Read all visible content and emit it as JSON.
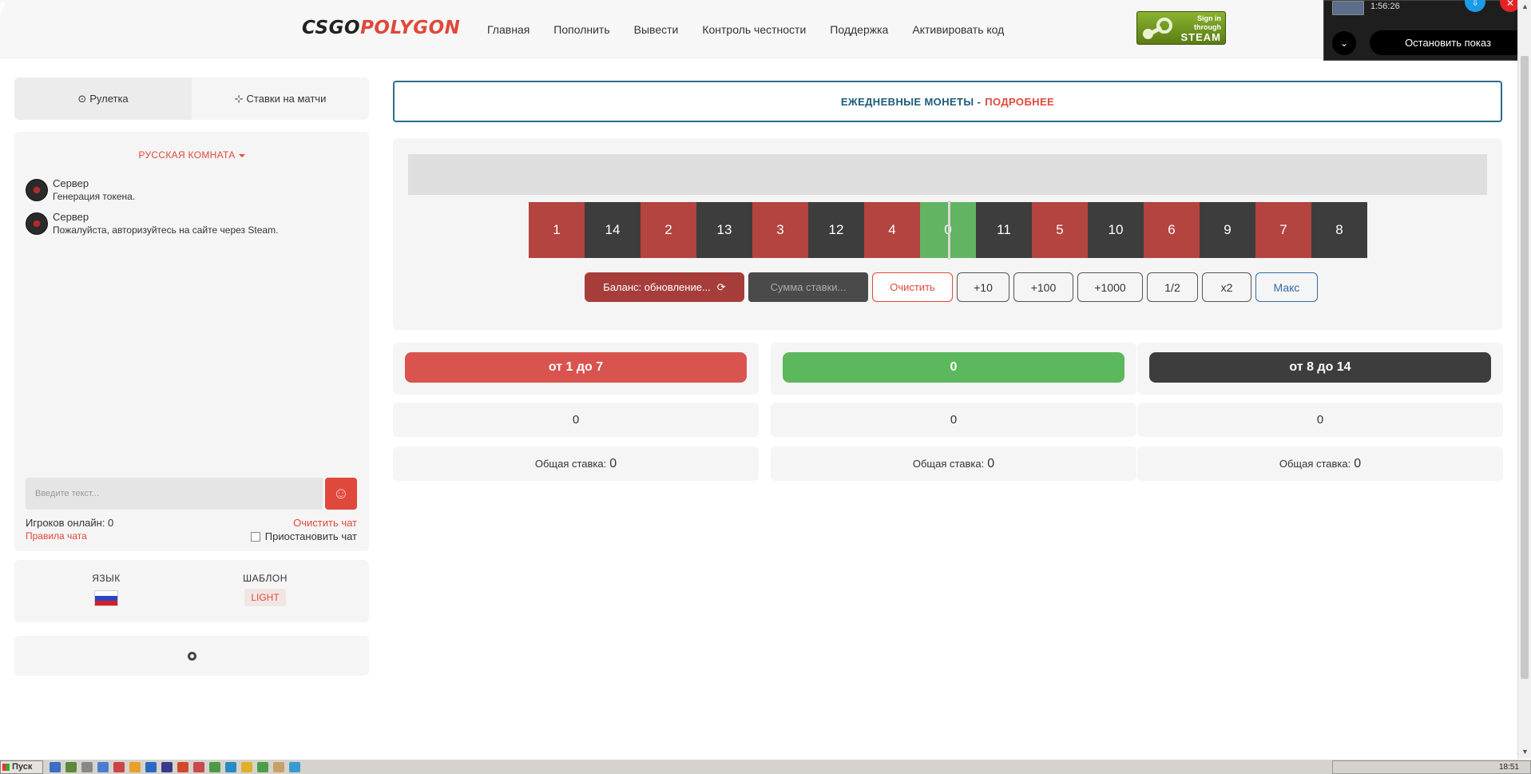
{
  "header": {
    "logo_part1": "CSGO",
    "logo_part2": "POLYGON",
    "nav": [
      "Главная",
      "Пополнить",
      "Вывести",
      "Контроль честности",
      "Поддержка",
      "Активировать код"
    ],
    "steam_line1": "Sign in",
    "steam_line2": "through",
    "steam_line3": "STEAM"
  },
  "share_overlay": {
    "time": "1:56:26",
    "stop_label": "Остановить показ"
  },
  "left": {
    "tabs": [
      {
        "icon": "⊙",
        "label": "Рулетка"
      },
      {
        "icon": "⊹",
        "label": "Ставки на матчи"
      }
    ],
    "room_label": "РУССКАЯ КОМНАТА",
    "messages": [
      {
        "name": "Сервер",
        "text": "Генерация токена."
      },
      {
        "name": "Сервер",
        "text": "Пожалуйста, авторизуйтесь на сайте через Steam."
      }
    ],
    "input_placeholder": "Введите текст...",
    "online": "Игроков онлайн: 0",
    "clear_chat": "Очистить чат",
    "rules": "Правила чата",
    "pause": "Приостановить чат",
    "lang_label": "ЯЗЫК",
    "template_label": "ШАБЛОН",
    "template_value": "LIGHT"
  },
  "banner": {
    "main": "ЕЖЕДНЕВНЫЕ МОНЕТЫ -",
    "more": "ПОДРОБНЕЕ"
  },
  "roulette": {
    "cells": [
      {
        "n": "1",
        "c": "red"
      },
      {
        "n": "14",
        "c": "black"
      },
      {
        "n": "2",
        "c": "red"
      },
      {
        "n": "13",
        "c": "black"
      },
      {
        "n": "3",
        "c": "red"
      },
      {
        "n": "12",
        "c": "black"
      },
      {
        "n": "4",
        "c": "red"
      },
      {
        "n": "0",
        "c": "green"
      },
      {
        "n": "11",
        "c": "black"
      },
      {
        "n": "5",
        "c": "red"
      },
      {
        "n": "10",
        "c": "black"
      },
      {
        "n": "6",
        "c": "red"
      },
      {
        "n": "9",
        "c": "black"
      },
      {
        "n": "7",
        "c": "red"
      },
      {
        "n": "8",
        "c": "black"
      }
    ],
    "balance": "Баланс: обновление...",
    "sum_placeholder": "Сумма ставки...",
    "clear": "Очистить",
    "quick": [
      "+10",
      "+100",
      "+1000",
      "1/2",
      "x2"
    ],
    "max": "Макс"
  },
  "bets": [
    {
      "label": "от 1 до 7",
      "color": "red",
      "count": "0",
      "total_label": "Общая ставка:",
      "total": "0"
    },
    {
      "label": "0",
      "color": "green",
      "count": "0",
      "total_label": "Общая ставка:",
      "total": "0"
    },
    {
      "label": "от 8 до 14",
      "color": "black",
      "count": "0",
      "total_label": "Общая ставка:",
      "total": "0"
    }
  ],
  "taskbar": {
    "start": "Пуск",
    "clock": "18:51"
  }
}
